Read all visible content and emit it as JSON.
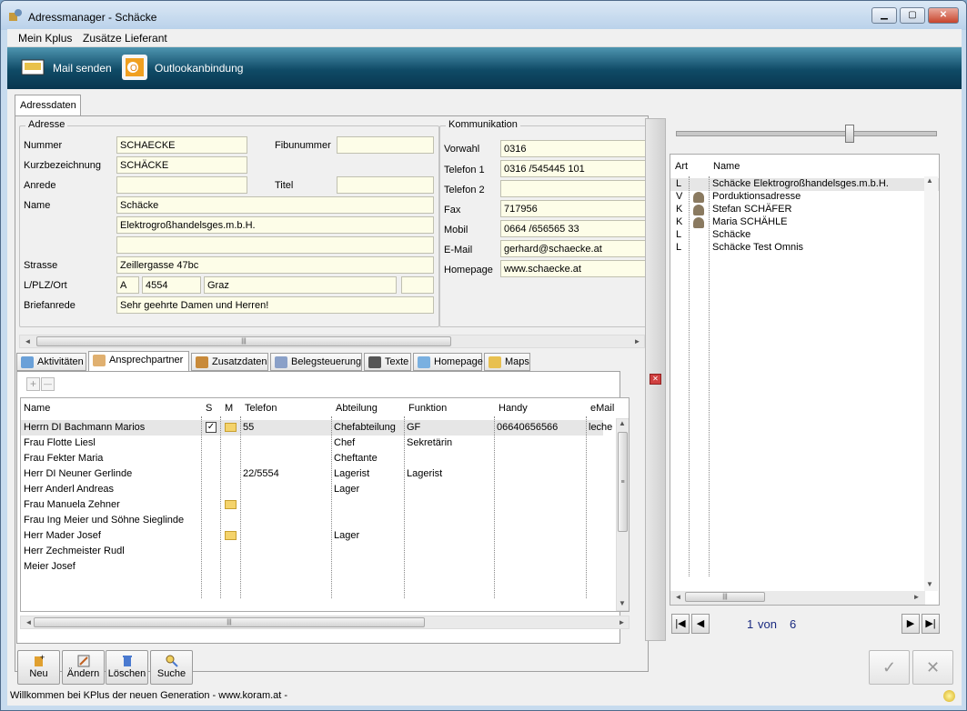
{
  "window": {
    "title": "Adressmanager - Schäcke",
    "min": "▁",
    "max": "▢",
    "close": "✕"
  },
  "menu": [
    "Mein Kplus",
    "Zusätze Lieferant"
  ],
  "toolbar": {
    "mail": "Mail senden",
    "outlook": "Outlookanbindung"
  },
  "tab_main": "Adressdaten",
  "adresse": {
    "group": "Adresse",
    "labels": {
      "nummer": "Nummer",
      "kurz": "Kurzbezeichnung",
      "anrede": "Anrede",
      "name": "Name",
      "strasse": "Strasse",
      "ort": "L/PLZ/Ort",
      "brief": "Briefanrede",
      "fibu": "Fibunummer",
      "titel": "Titel"
    },
    "nummer": "SCHAECKE",
    "kurz": "SCHÄCKE",
    "anrede": "",
    "fibu": "",
    "titel": "",
    "name1": "Schäcke",
    "name2": "Elektrogroßhandelsges.m.b.H.",
    "name3": "",
    "strasse": "Zeillergasse 47bc",
    "land": "A",
    "plz": "4554",
    "ort": "Graz",
    "extra": "",
    "brief": "Sehr geehrte Damen und Herren!"
  },
  "komm": {
    "group": "Kommunikation",
    "labels": {
      "vorwahl": "Vorwahl",
      "tel1": "Telefon 1",
      "tel2": "Telefon 2",
      "fax": "Fax",
      "mobil": "Mobil",
      "email": "E-Mail",
      "home": "Homepage"
    },
    "vorwahl": "0316",
    "tel1": "0316 /545445 101",
    "tel2": "",
    "fax": "717956",
    "mobil": "0664 /656565 33",
    "email": "gerhard@schaecke.at",
    "home": "www.schaecke.at"
  },
  "subtabs": [
    "Aktivitäten",
    "Ansprechpartner",
    "Zusatzdaten",
    "Belegsteuerung",
    "Texte",
    "Homepage",
    "Maps"
  ],
  "contacts": {
    "add": "+",
    "remove": "—",
    "headers": [
      "Name",
      "S",
      "M",
      "Telefon",
      "Abteilung",
      "Funktion",
      "Handy",
      "eMail"
    ],
    "rows": [
      {
        "name": "Herrn DI Bachmann Marios",
        "tel": "55",
        "abt": "Chefabteilung",
        "fkt": "GF",
        "handy": "06640656566",
        "email": "leche",
        "s": "✓",
        "m": true
      },
      {
        "name": "Frau Flotte Liesl",
        "tel": "",
        "abt": "Chef",
        "fkt": "Sekretärin",
        "handy": "",
        "email": "",
        "s": "",
        "m": false
      },
      {
        "name": "Frau Fekter Maria",
        "tel": "",
        "abt": "Cheftante",
        "fkt": "",
        "handy": "",
        "email": "",
        "s": "",
        "m": false
      },
      {
        "name": "Herr DI Neuner Gerlinde",
        "tel": "22/5554",
        "abt": "Lagerist",
        "fkt": "Lagerist",
        "handy": "",
        "email": "",
        "s": "",
        "m": false
      },
      {
        "name": "Herr Anderl Andreas",
        "tel": "",
        "abt": "Lager",
        "fkt": "",
        "handy": "",
        "email": "",
        "s": "",
        "m": false
      },
      {
        "name": "Frau Manuela Zehner",
        "tel": "",
        "abt": "",
        "fkt": "",
        "handy": "",
        "email": "",
        "s": "",
        "m": true
      },
      {
        "name": "Frau Ing Meier und Söhne Sieglinde",
        "tel": "",
        "abt": "",
        "fkt": "",
        "handy": "",
        "email": "",
        "s": "",
        "m": false
      },
      {
        "name": "Herr Mader Josef",
        "tel": "",
        "abt": "Lager",
        "fkt": "",
        "handy": "",
        "email": "",
        "s": "",
        "m": true
      },
      {
        "name": "Herr Zechmeister Rudl",
        "tel": "",
        "abt": "",
        "fkt": "",
        "handy": "",
        "email": "",
        "s": "",
        "m": false
      },
      {
        "name": "Meier Josef",
        "tel": "",
        "abt": "",
        "fkt": "",
        "handy": "",
        "email": "",
        "s": "",
        "m": false
      }
    ]
  },
  "addresses": {
    "headers": [
      "Art",
      "Name"
    ],
    "rows": [
      {
        "art": "L",
        "name": "Schäcke Elektrogroßhandelsges.m.b.H.",
        "icon": false
      },
      {
        "art": "V",
        "name": "Porduktionsadresse",
        "icon": true
      },
      {
        "art": "K",
        "name": "Stefan SCHÄFER",
        "icon": true
      },
      {
        "art": "K",
        "name": "Maria SCHÄHLE",
        "icon": true
      },
      {
        "art": "L",
        "name": "Schäcke",
        "icon": false
      },
      {
        "art": "L",
        "name": "Schäcke Test Omnis",
        "icon": false
      }
    ],
    "pager_current": "1",
    "pager_sep": "von",
    "pager_total": "6"
  },
  "buttons": {
    "neu": "Neu",
    "aendern": "Ändern",
    "loeschen": "Löschen",
    "suche": "Suche",
    "ok": "✓",
    "cancel": "✕"
  },
  "status": "Willkommen bei KPlus der neuen Generation - www.koram.at -"
}
